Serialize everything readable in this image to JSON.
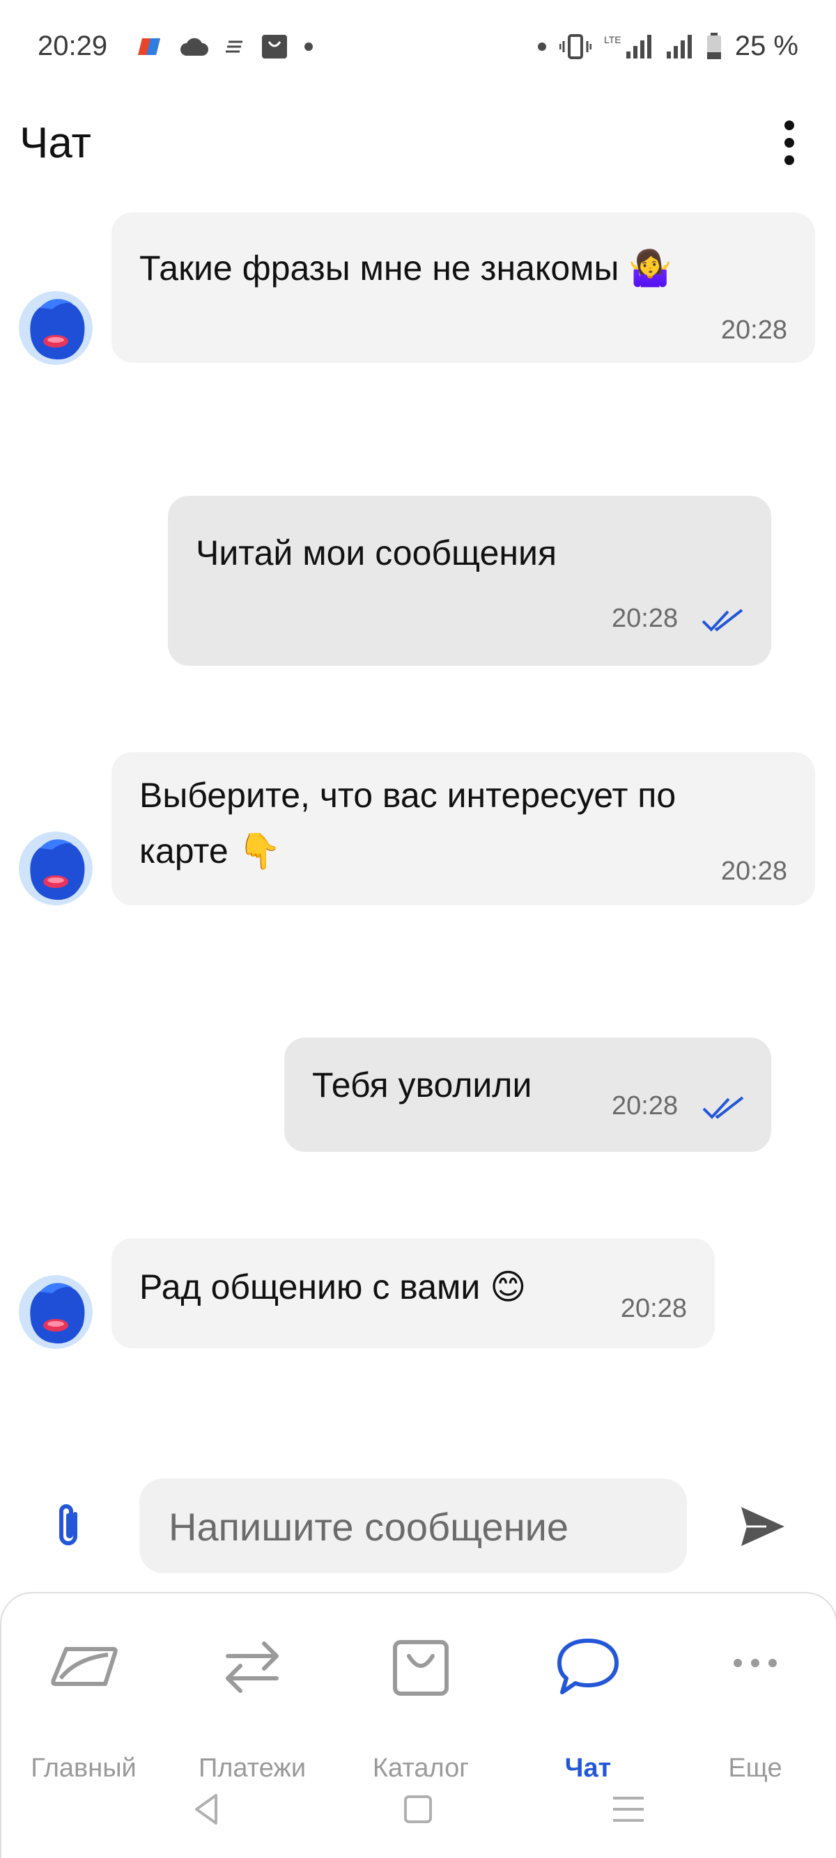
{
  "status_bar": {
    "time": "20:29",
    "battery": "25 %",
    "icons_left": [
      "app-logo-icon",
      "cloud-icon",
      "notes-icon",
      "bag-icon",
      "dot-icon"
    ],
    "icons_right": [
      "dot-icon",
      "vibrate-icon",
      "lte-signal-icon",
      "signal-icon",
      "battery-icon"
    ]
  },
  "header": {
    "title": "Чат",
    "menu_icon": "more-vertical-icon"
  },
  "messages": [
    {
      "direction": "incoming",
      "text": "Такие фразы мне не знакомы 🤷‍♀️",
      "time": "20:28"
    },
    {
      "direction": "outgoing",
      "text": "Читай мои сообщения",
      "time": "20:28",
      "status": "read"
    },
    {
      "direction": "incoming",
      "text_line1": "Выберите, что вас интересует по",
      "text_line2": "карте 👇",
      "time": "20:28"
    },
    {
      "direction": "outgoing",
      "text": "Тебя уволили",
      "time": "20:28",
      "status": "read"
    },
    {
      "direction": "incoming",
      "text": "Рад общению с вами 😊",
      "time": "20:28"
    }
  ],
  "composer": {
    "placeholder": "Напишите сообщение",
    "attach_icon": "paperclip-icon",
    "send_icon": "send-icon"
  },
  "bottom_nav": {
    "items": [
      {
        "label": "Главный",
        "icon": "home-card-icon",
        "active": false
      },
      {
        "label": "Платежи",
        "icon": "transfer-arrows-icon",
        "active": false
      },
      {
        "label": "Каталог",
        "icon": "shopping-bag-icon",
        "active": false
      },
      {
        "label": "Чат",
        "icon": "chat-bubble-icon",
        "active": true
      },
      {
        "label": "Еще",
        "icon": "more-horizontal-icon",
        "active": false
      }
    ]
  },
  "colors": {
    "accent": "#2357d8",
    "incoming_bubble": "#f3f3f3",
    "outgoing_bubble": "#e8e8e8",
    "inactive_nav": "#9a9a9a"
  }
}
